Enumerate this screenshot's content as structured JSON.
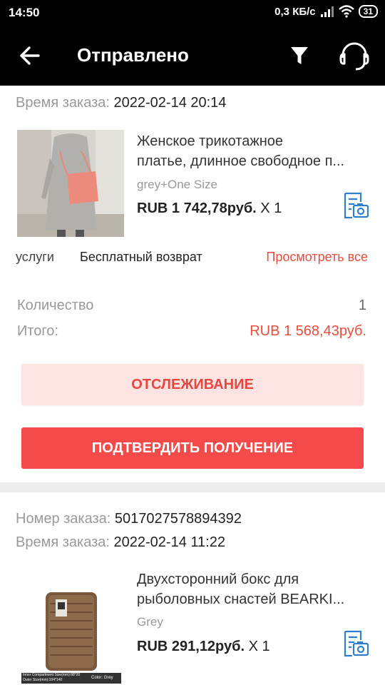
{
  "status_bar": {
    "time": "14:50",
    "net_speed": "0,3 КБ/с",
    "battery": "31"
  },
  "header": {
    "title": "Отправлено"
  },
  "orders": [
    {
      "time_label": "Время заказа:",
      "time_value": "2022-02-14 20:14",
      "product": {
        "name_line1": "Женское трикотажное",
        "name_line2": "платье, длинное свободное п...",
        "variant": "grey+One Size",
        "price": "RUB 1 742,78руб.",
        "qty": "X 1"
      },
      "services": {
        "label": "услуги",
        "value": "Бесплатный возврат",
        "link": "Просмотреть все"
      },
      "quantity_label": "Количество",
      "quantity_value": "1",
      "total_label": "Итого:",
      "total_value": "RUB 1 568,43руб.",
      "track_button": "ОТСЛЕЖИВАНИЕ",
      "confirm_button": "ПОДТВЕРДИТЬ ПОЛУЧЕНИЕ"
    },
    {
      "number_label": "Номер заказа:",
      "number_value": "5017027578894392",
      "time_label": "Время заказа:",
      "time_value": "2022-02-14 11:22",
      "product": {
        "name_line1": "Двухсторонний бокс для",
        "name_line2": "рыболовных снастей BEARKI...",
        "variant": "Grey",
        "price": "RUB 291,12руб.",
        "qty": "X 1",
        "image_caption": "Inner Compartment Size(mm):88*20  Outer Size(mm):104*140",
        "image_color": "Color: Grey"
      }
    }
  ],
  "colors": {
    "accent": "#f54a4a",
    "link": "#e74c3c",
    "icon": "#2f7fd1"
  }
}
